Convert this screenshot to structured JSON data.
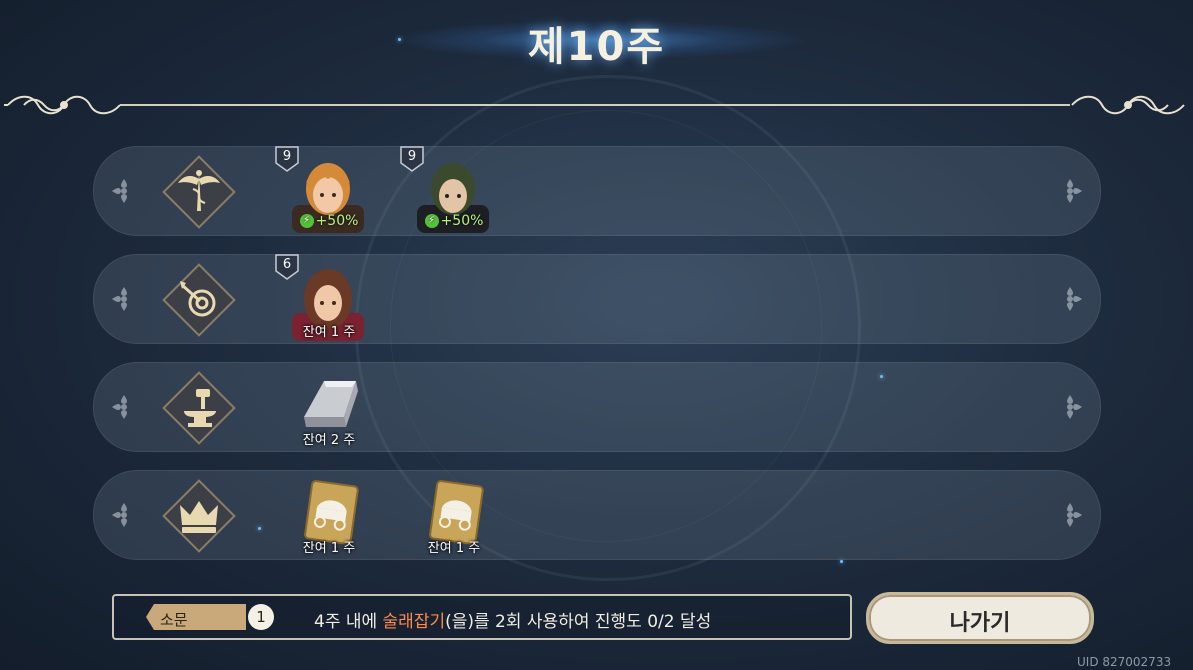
{
  "title": "제10주",
  "rows": [
    {
      "icon": "caduceus-icon",
      "items": [
        {
          "type": "character",
          "level": "9",
          "boost": "+50%",
          "hair": "#d58a3a",
          "face": "#f2c9a6",
          "cloth": "#3a2a22"
        },
        {
          "type": "character",
          "level": "9",
          "boost": "+50%",
          "hair": "#3b4a2c",
          "face": "#e4c4a6",
          "cloth": "#1d1f24"
        }
      ]
    },
    {
      "icon": "archery-target-icon",
      "items": [
        {
          "type": "character",
          "level": "6",
          "caption": "잔여 1 주",
          "hair": "#6a3a26",
          "face": "#f0c8a8",
          "cloth": "#7a2230"
        }
      ]
    },
    {
      "icon": "anvil-hammer-icon",
      "items": [
        {
          "type": "ingot",
          "caption": "잔여 2 주"
        }
      ]
    },
    {
      "icon": "crown-icon",
      "items": [
        {
          "type": "wagon-card",
          "caption": "잔여 1 주"
        },
        {
          "type": "wagon-card",
          "caption": "잔여 1 주"
        }
      ]
    }
  ],
  "rumor": {
    "label": "소문",
    "count": "1",
    "mission_prefix": "4주 내에 ",
    "mission_highlight": "술래잡기",
    "mission_suffix": "(을)를 2회 사용하여 진행도 0/2 달성"
  },
  "exit_label": "나가기",
  "uid": "UID 827002733",
  "colors": {
    "highlight": "#ff8a4a",
    "boost": "#b8f07a",
    "frame": "#e7e1cf"
  }
}
